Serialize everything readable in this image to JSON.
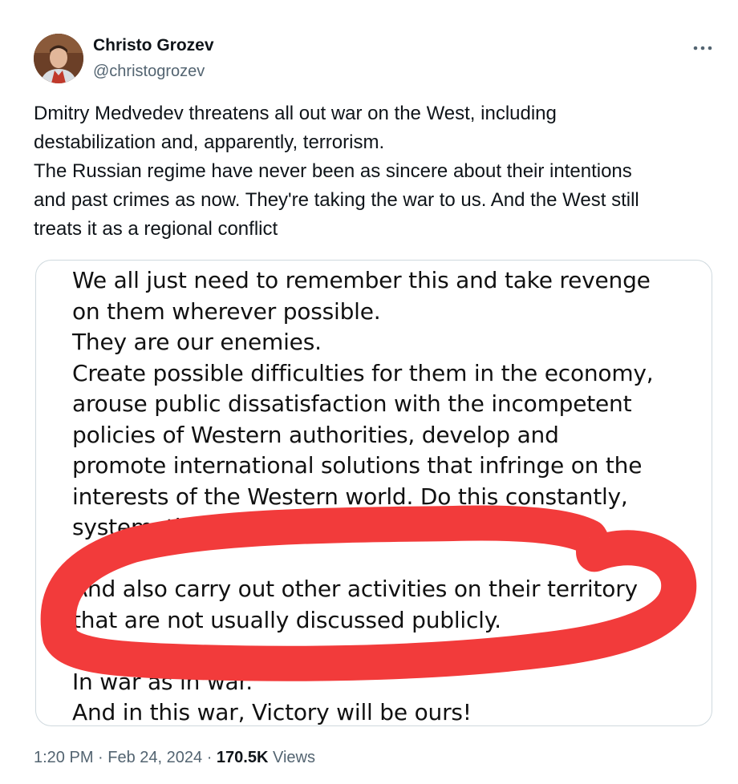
{
  "author": {
    "name": "Christo Grozev",
    "handle": "@christogrozev"
  },
  "tweet": {
    "lines": [
      "Dmitry Medvedev threatens all out war on the West, including",
      "destabilization and, apparently, terrorism.",
      "The Russian regime have never been as sincere about their intentions",
      "and past crimes as now. They're taking the war to us. And the West still",
      "treats it as a regional conflict"
    ]
  },
  "media": {
    "quote_lines": [
      "We all just need to remember this and take revenge",
      "on them wherever possible.",
      "They are our enemies.",
      "Create possible difficulties for them in the economy,",
      "arouse public dissatisfaction with the incompetent",
      "policies of Western authorities, develop and",
      "promote international solutions that infringe on the",
      "interests of the Western world. Do this constantly,",
      "systematically and as openly as possible."
    ],
    "circled_lines": [
      "And also carry out other activities on their territory",
      "that are not usually discussed publicly."
    ],
    "closing_lines": [
      "In war as in war.",
      "And in this war, Victory will be ours!"
    ],
    "annotation_color": "#f23b3b"
  },
  "meta": {
    "time": "1:20 PM",
    "separator": " · ",
    "date": "Feb 24, 2024",
    "views_count": "170.5K",
    "views_label": " Views"
  },
  "icons": {
    "more": "more-dots-icon",
    "avatar": "avatar-photo"
  },
  "colors": {
    "text_primary": "#0f1419",
    "text_secondary": "#536471",
    "border": "#cfd9de"
  }
}
